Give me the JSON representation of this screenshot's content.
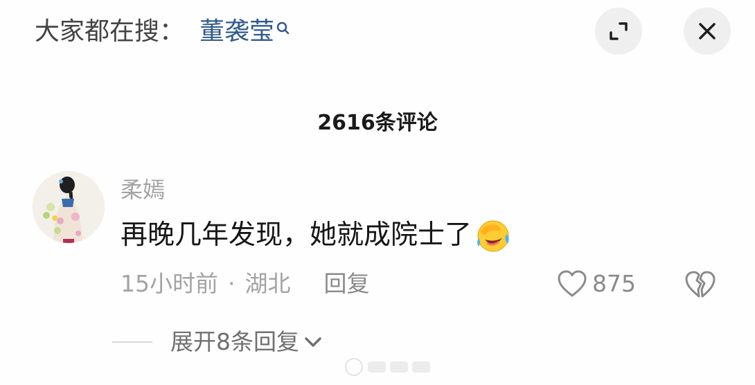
{
  "header": {
    "search_prefix": "大家都在搜：",
    "search_term": "董袭莹",
    "icons": {
      "search": "search-icon",
      "expand": "expand-icon",
      "close": "close-icon"
    }
  },
  "comments": {
    "title": "2616条评论"
  },
  "comment": {
    "username": "柔嫣",
    "text": "再晚几年发现，她就成院士了",
    "emoji": "laugh-cry-emoji",
    "time": "15小时前",
    "separator": "·",
    "location": "湖北",
    "reply_label": "回复",
    "like_count": "875"
  },
  "replies": {
    "expand_label": "展开8条回复"
  },
  "colors": {
    "link": "#2f5a8e",
    "muted": "#a3a3a3",
    "text": "#161616",
    "button_bg": "#efefef"
  }
}
